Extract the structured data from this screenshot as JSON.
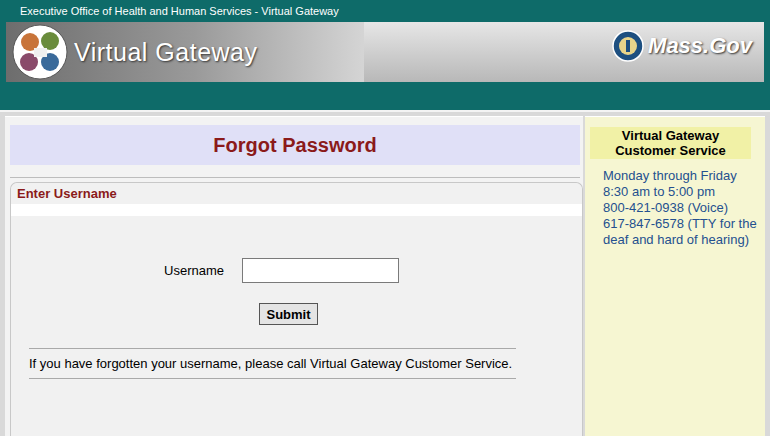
{
  "header": {
    "agency": "Executive Office of Health and Human Services - Virtual Gateway",
    "site_title": "Virtual Gateway",
    "logo_text": "Mass.Gov"
  },
  "form": {
    "title": "Forgot Password",
    "section": "Enter Username",
    "username_label": "Username",
    "username_value": "",
    "submit": "Submit",
    "note": "If you have forgotten your username, please call Virtual Gateway Customer Service."
  },
  "sidebar": {
    "title": "Virtual Gateway Customer Service",
    "lines": [
      "Monday through Friday",
      "8:30 am to 5:00 pm",
      "800-421-0938 (Voice)",
      "617-847-6578 (TTY for the deaf and hard of hearing)"
    ]
  }
}
